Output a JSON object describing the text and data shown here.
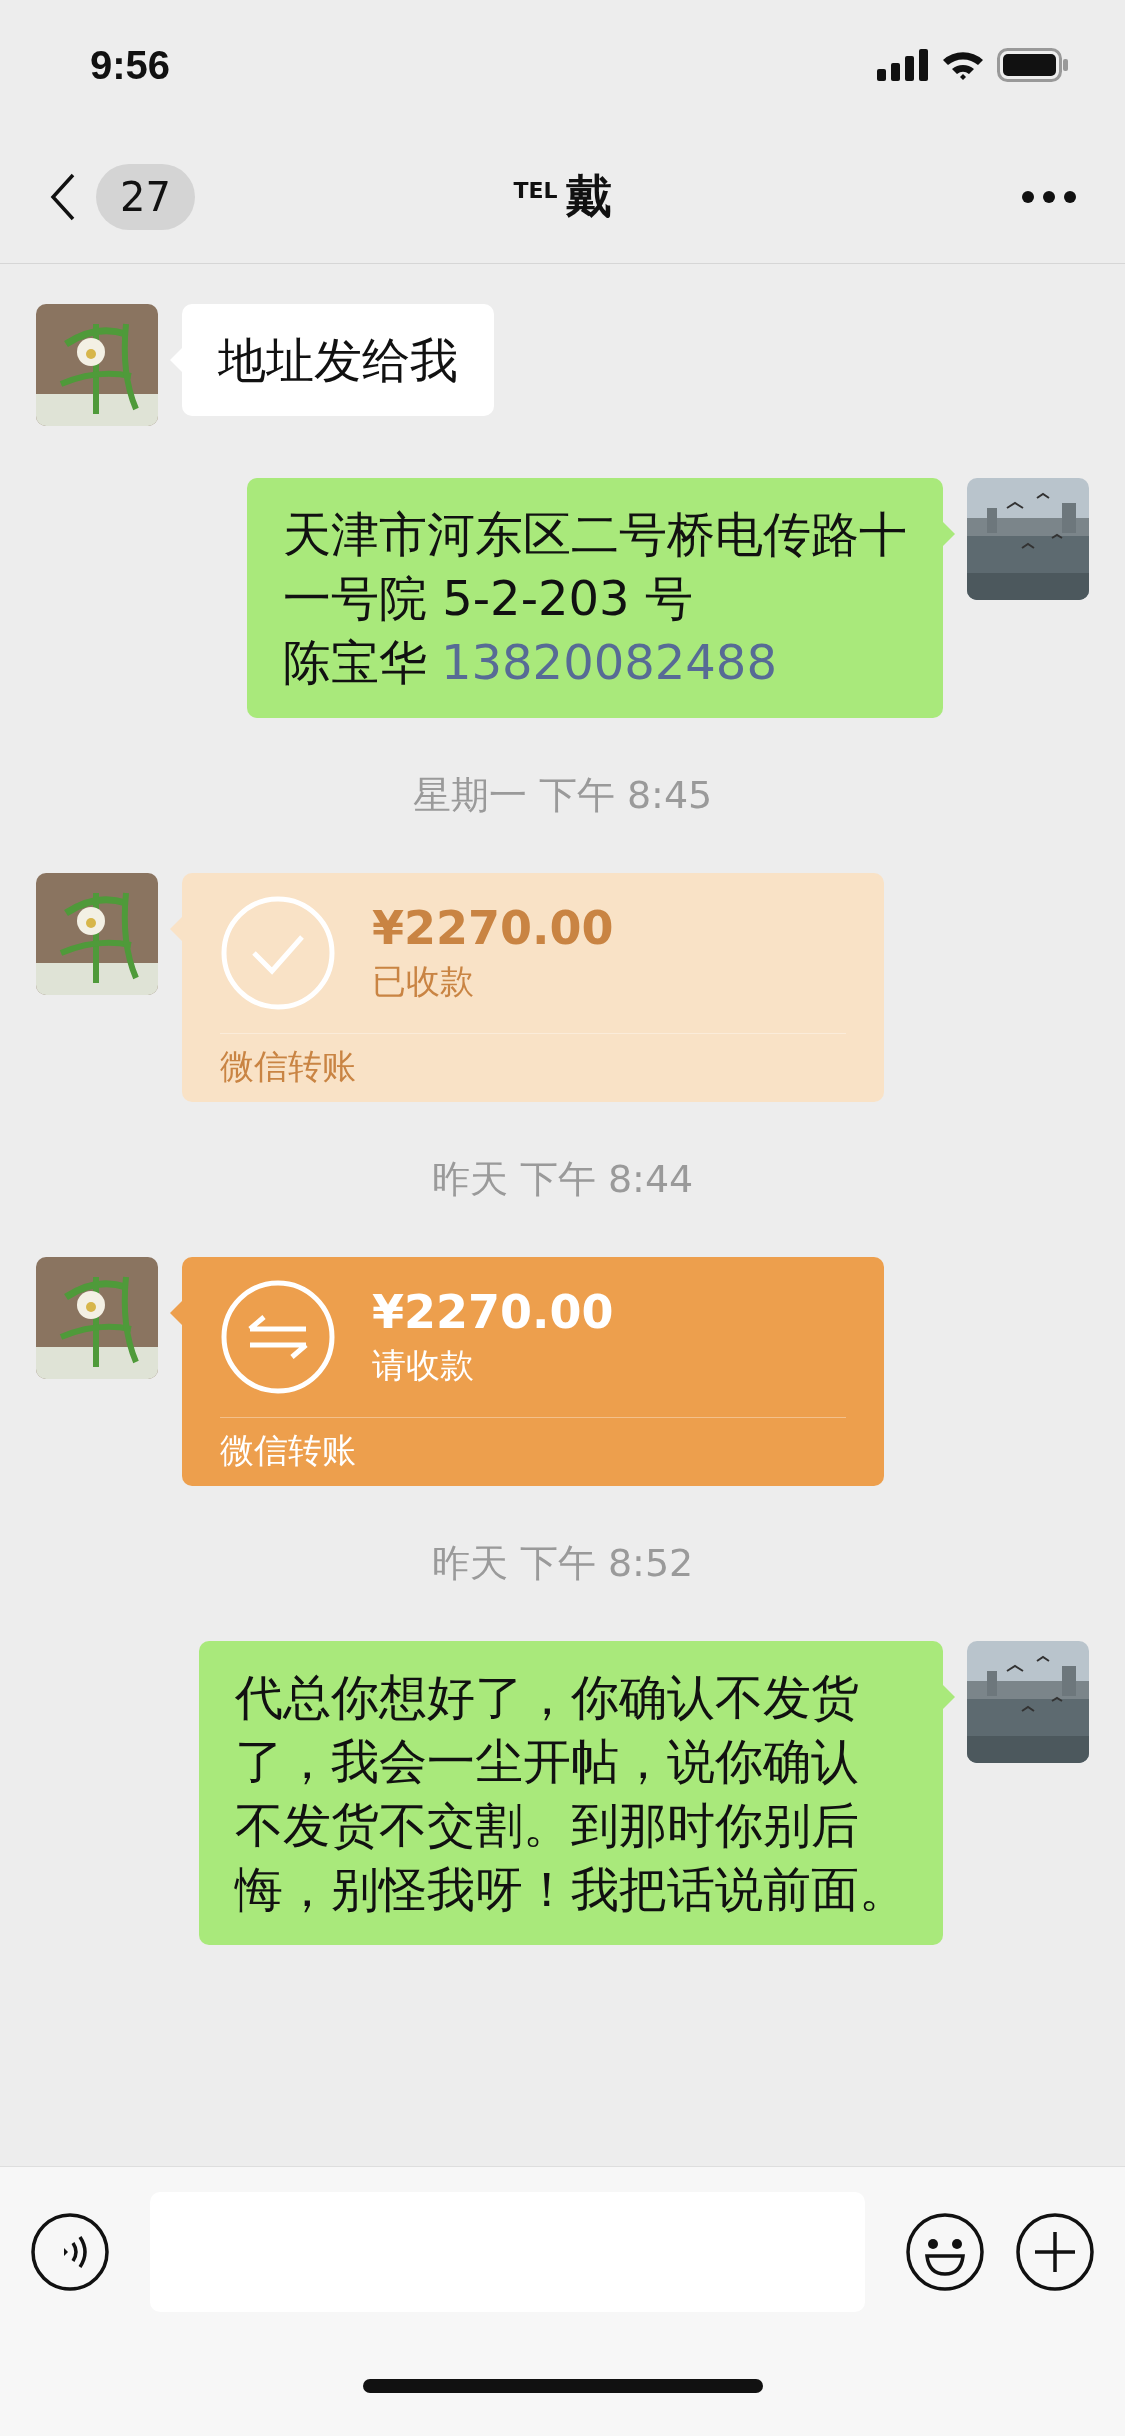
{
  "status_bar": {
    "time": "9:56"
  },
  "nav": {
    "unread": "27",
    "title_prefix": "TEL",
    "title": "戴"
  },
  "messages": [
    {
      "kind": "text",
      "outgoing": false,
      "lines": [
        "地址发给我"
      ]
    },
    {
      "kind": "text",
      "outgoing": true,
      "lines": [
        "天津市河东区二号桥电传路十",
        "一号院 5-2-203 号",
        "陈宝华"
      ],
      "phone": "13820082488"
    },
    {
      "kind": "time",
      "text": "星期一 下午 8:45"
    },
    {
      "kind": "transfer",
      "outgoing": false,
      "received": true,
      "amount": "¥2270.00",
      "status": "已收款",
      "footer": "微信转账"
    },
    {
      "kind": "time",
      "text": "昨天 下午 8:44"
    },
    {
      "kind": "transfer",
      "outgoing": false,
      "received": false,
      "amount": "¥2270.00",
      "status": "请收款",
      "footer": "微信转账"
    },
    {
      "kind": "time",
      "text": "昨天 下午 8:52"
    },
    {
      "kind": "text",
      "outgoing": true,
      "lines": [
        "代总你想好了，你确认不发货",
        "了，我会一尘开帖，说你确认",
        "不发货不交割。到那时你别后",
        "悔，别怪我呀！我把话说前面。"
      ]
    }
  ]
}
